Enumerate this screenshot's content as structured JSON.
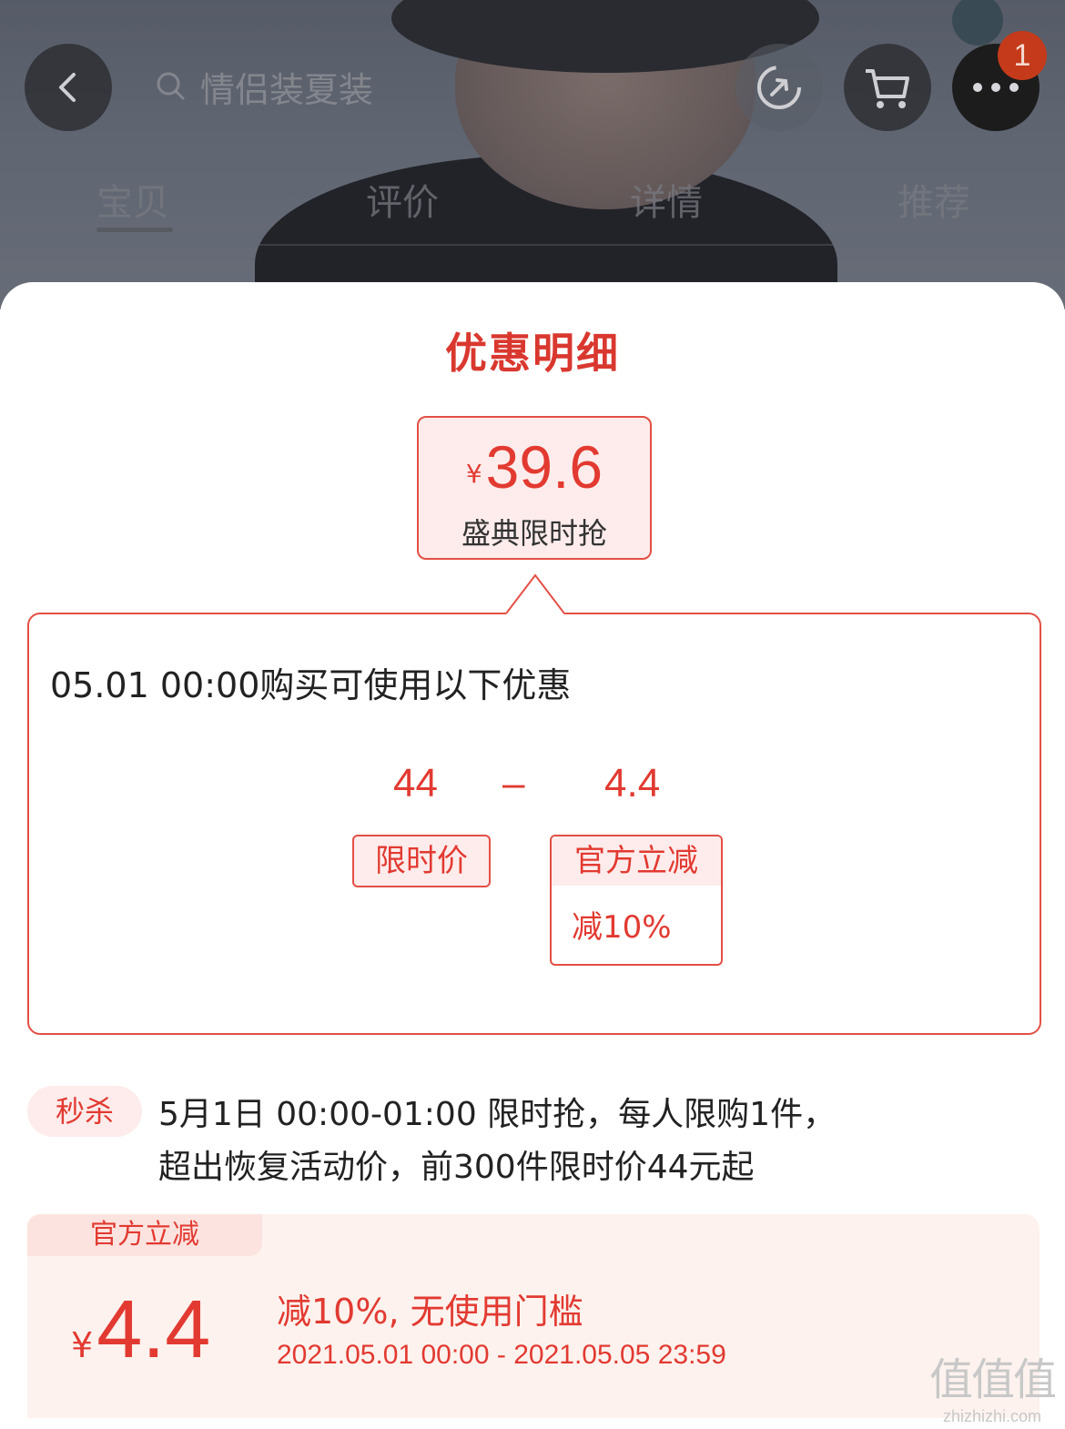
{
  "header": {
    "search_text": "情侣装夏装",
    "cart_badge": "1",
    "tabs": [
      "宝贝",
      "评价",
      "详情",
      "推荐"
    ]
  },
  "sheet": {
    "title": "优惠明细",
    "price": {
      "currency": "¥",
      "value": "39.6",
      "label": "盛典限时抢"
    },
    "detail": {
      "heading": "05.01 00:00购买可使用以下优惠",
      "base_value": "44",
      "operator": "–",
      "discount_value": "4.4",
      "base_tag": "限时价",
      "discount_tag_title": "官方立减",
      "discount_tag_body": "减10%"
    },
    "miaosha": {
      "tag": "秒杀",
      "line1": "5月1日 00:00-01:00 限时抢，每人限购1件，",
      "line2": "超出恢复活动价，前300件限时价44元起"
    },
    "coupon": {
      "tab": "官方立减",
      "currency": "¥",
      "amount": "4.4",
      "desc": "减10%, 无使用门槛",
      "dates": "2021.05.01 00:00 - 2021.05.05 23:59"
    }
  },
  "watermark": {
    "logo": "值值值",
    "url": "zhizhizhi.com"
  },
  "colors": {
    "accent": "#e23a31",
    "accent_light": "#fdeceb"
  }
}
